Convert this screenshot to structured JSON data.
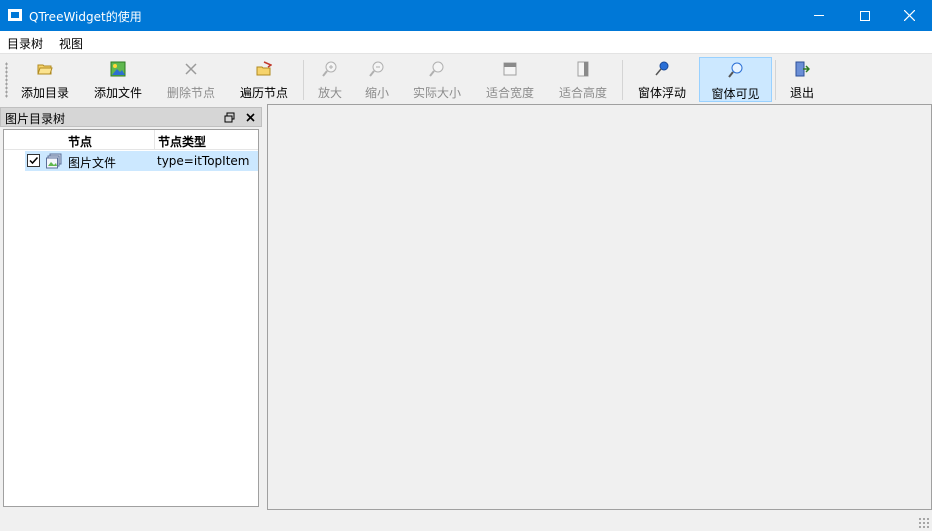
{
  "window": {
    "title": "QTreeWidget的使用"
  },
  "menubar": {
    "items": [
      "目录树",
      "视图"
    ]
  },
  "toolbar": {
    "buttons": [
      {
        "label": "添加目录",
        "icon": "folder-open-icon",
        "enabled": true
      },
      {
        "label": "添加文件",
        "icon": "image-file-icon",
        "enabled": true
      },
      {
        "label": "删除节点",
        "icon": "delete-x-icon",
        "enabled": false
      },
      {
        "label": "遍历节点",
        "icon": "traverse-folder-icon",
        "enabled": true
      },
      {
        "label": "放大",
        "icon": "zoom-in-icon",
        "enabled": false
      },
      {
        "label": "缩小",
        "icon": "zoom-out-icon",
        "enabled": false
      },
      {
        "label": "实际大小",
        "icon": "zoom-actual-icon",
        "enabled": false
      },
      {
        "label": "适合宽度",
        "icon": "fit-width-icon",
        "enabled": false
      },
      {
        "label": "适合高度",
        "icon": "fit-height-icon",
        "enabled": false
      },
      {
        "label": "窗体浮动",
        "icon": "pin-icon",
        "enabled": true
      },
      {
        "label": "窗体可见",
        "icon": "magnifier-icon",
        "enabled": true,
        "checked": true
      },
      {
        "label": "退出",
        "icon": "exit-door-icon",
        "enabled": true
      }
    ]
  },
  "dock": {
    "title": "图片目录树",
    "tree": {
      "headers": [
        "节点",
        "节点类型"
      ],
      "rows": [
        {
          "name": "图片文件",
          "type": "type=itTopItem",
          "checked": true,
          "selected": true
        }
      ]
    }
  },
  "colors": {
    "titlebar": "#0078d7",
    "selection": "#cce8ff",
    "active_button": "#cce8ff"
  }
}
